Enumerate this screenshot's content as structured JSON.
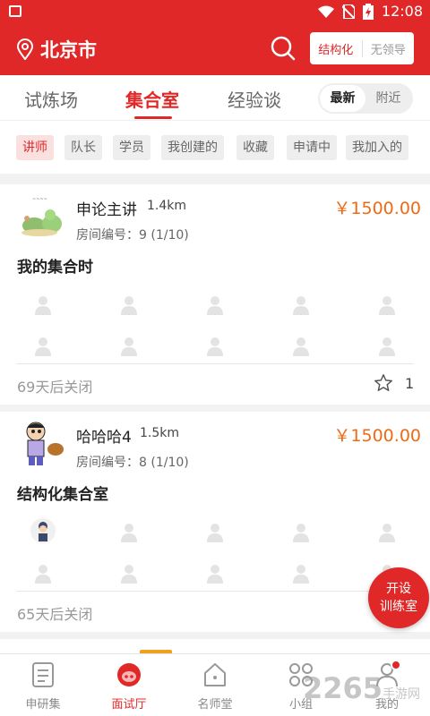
{
  "statusbar": {
    "time": "12:08"
  },
  "header": {
    "city": "北京市",
    "segment": {
      "active": "结构化",
      "inactive": "无领导"
    }
  },
  "tabs": {
    "items": [
      "试炼场",
      "集合室",
      "经验谈"
    ],
    "active_index": 1,
    "sort": {
      "on": "最新",
      "off": "附近"
    }
  },
  "filters": [
    "讲师",
    "队长",
    "学员",
    "我创建的",
    "收藏",
    "申请中",
    "我加入的"
  ],
  "cards": [
    {
      "name": "申论主讲",
      "distance": "1.4km",
      "price": "￥1500.00",
      "room": "房间编号：9   (1/10)",
      "title": "我的集合时",
      "closing": "69天后关闭",
      "fav_count": "1"
    },
    {
      "name": "哈哈哈4",
      "distance": "1.5km",
      "price": "￥1500.00",
      "room": "房间编号：8   (1/10)",
      "title": "结构化集合室",
      "closing": "65天后关闭"
    }
  ],
  "fab": {
    "line1": "开设",
    "line2": "训练室"
  },
  "bottomnav": [
    {
      "label": "申研集",
      "icon": "document-icon"
    },
    {
      "label": "面试厅",
      "icon": "pig-face-icon"
    },
    {
      "label": "名师堂",
      "icon": "house-icon"
    },
    {
      "label": "小组",
      "icon": "group-icon"
    },
    {
      "label": "我的",
      "icon": "person-icon"
    }
  ],
  "watermark": {
    "big": "2265",
    "small": "手游网"
  },
  "colors": {
    "brand": "#e02828",
    "price": "#f06a14"
  }
}
